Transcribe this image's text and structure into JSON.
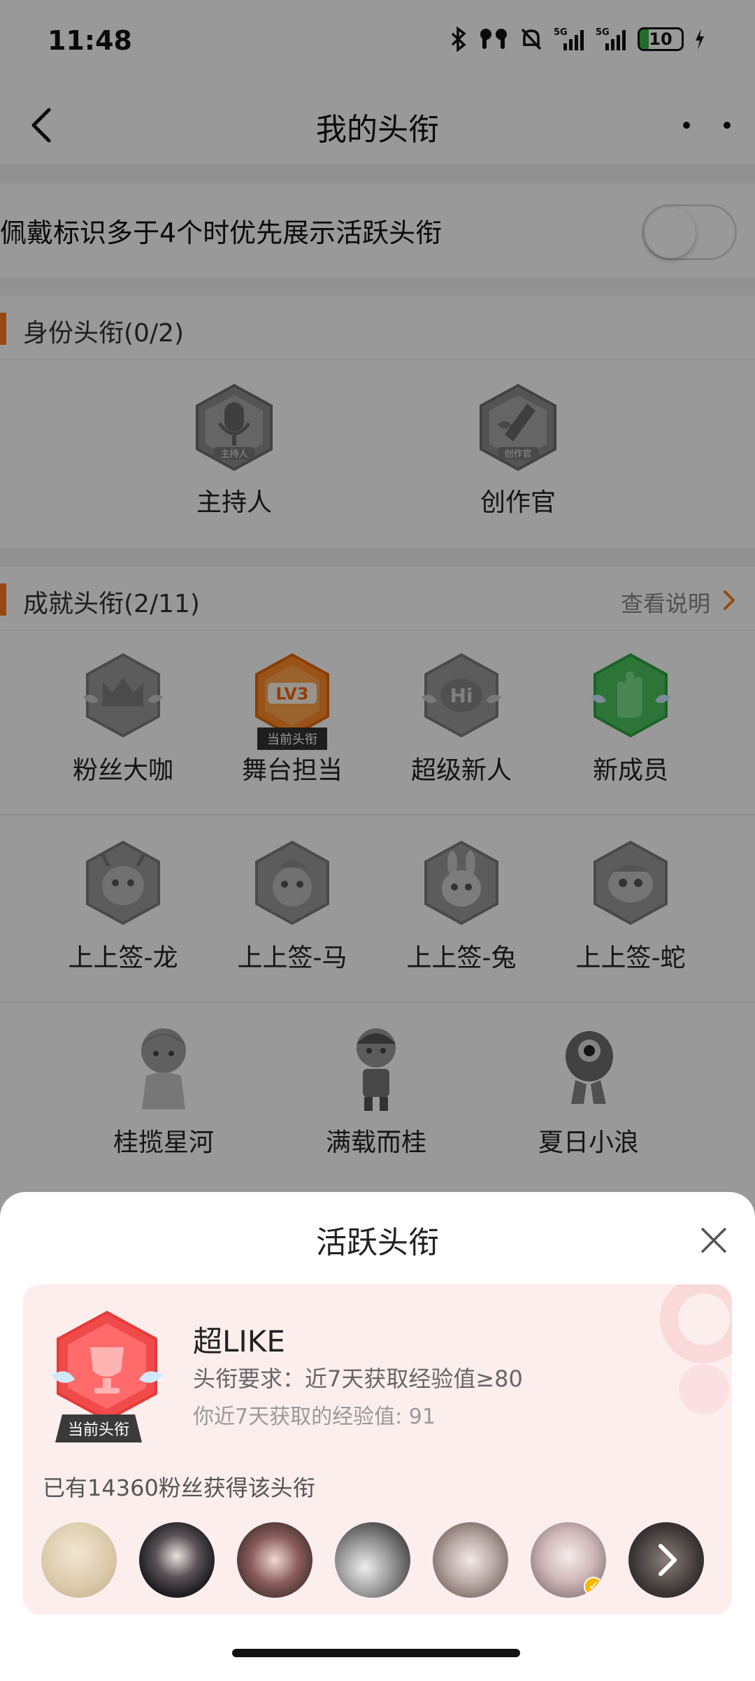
{
  "status_bar": {
    "time": "11:48",
    "battery_level": "10",
    "icons": [
      "bluetooth-icon",
      "earbuds-icon",
      "bell-off-icon",
      "signal-5g-icon",
      "signal-5g-icon",
      "battery-icon",
      "charging-icon"
    ],
    "signal_label_1": "5G",
    "signal_label_2": "5G"
  },
  "nav": {
    "title": "我的头衔",
    "back_icon": "chevron-left-icon",
    "more_icon": "more-close-icon"
  },
  "settings": {
    "priority_toggle_label": "佩戴标识多于4个时优先展示活跃头衔",
    "priority_toggle_on": false
  },
  "identity_section": {
    "header": "身份头衔(0/2)",
    "badges": [
      {
        "name": "主持人",
        "badge_text": "主持人"
      },
      {
        "name": "创作官",
        "badge_text": "创作官"
      }
    ]
  },
  "achievement_section": {
    "header": "成就头衔(2/11)",
    "link": "查看说明",
    "current_tag": "当前头衔",
    "badges": [
      {
        "name": "粉丝大咖",
        "lit": false
      },
      {
        "name": "舞台担当",
        "lit": true,
        "current": true,
        "badge_text": "LV3"
      },
      {
        "name": "超级新人",
        "lit": false,
        "badge_text": "Hi"
      },
      {
        "name": "新成员",
        "lit": true
      },
      {
        "name": "上上签-龙",
        "lit": false
      },
      {
        "name": "上上签-马",
        "lit": false
      },
      {
        "name": "上上签-兔",
        "lit": false
      },
      {
        "name": "上上签-蛇",
        "lit": false
      },
      {
        "name": "桂揽星河",
        "lit": false
      },
      {
        "name": "满载而桂",
        "lit": false
      },
      {
        "name": "夏日小浪",
        "lit": false
      }
    ]
  },
  "sheet": {
    "title": "活跃头衔",
    "title_name": "超LIKE",
    "requirement": "头衔要求：近7天获取经验值≥80",
    "your_exp": "你近7天获取的经验值: 91",
    "current_tag": "当前头衔",
    "fans_count_text": "已有14360粉丝获得该头衔",
    "avatars": [
      {
        "label": "fan-avatar-1",
        "color": "#e8d9c4"
      },
      {
        "label": "fan-avatar-2",
        "color": "#2a2a2e"
      },
      {
        "label": "fan-avatar-3",
        "color": "#6b4a4a"
      },
      {
        "label": "fan-avatar-4",
        "color": "#9a9a9a"
      },
      {
        "label": "fan-avatar-5",
        "color": "#cfcac8"
      },
      {
        "label": "fan-avatar-6",
        "color": "#d8c8c8",
        "verified": true
      },
      {
        "label": "fan-avatar-more",
        "color": "#3a3a3a"
      }
    ],
    "colors": {
      "accent": "#ff7a1a",
      "card_bg": "#fdeeee",
      "badge_red": "#f04a4a"
    }
  }
}
